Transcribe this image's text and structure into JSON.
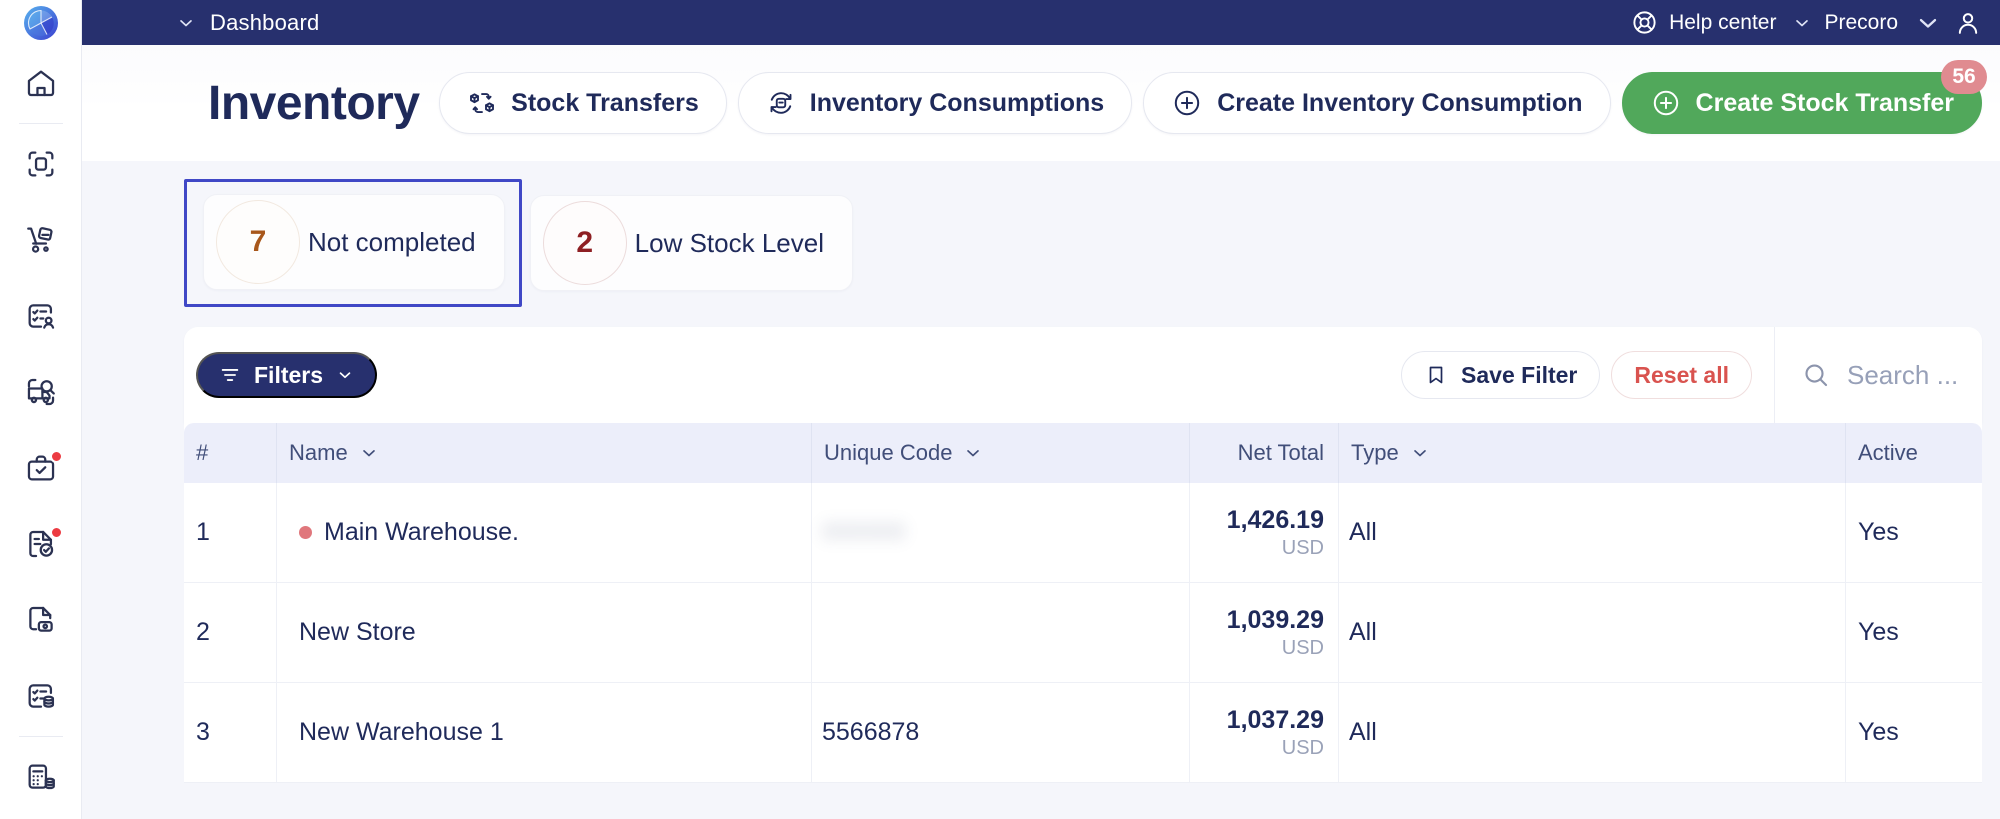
{
  "brand": {
    "accent_primary": "#27306e",
    "accent_green": "#51a85b",
    "focus_outline": "#4048c6",
    "badge_pink": "#e08b90",
    "danger": "#d9534f"
  },
  "topbar": {
    "menu_label": "Dashboard",
    "help_label": "Help center",
    "org_label": "Precoro",
    "icons": {
      "menu_chevron": "chevron-down-icon",
      "help": "lifebuoy-icon",
      "org_chevron": "chevron-down-icon",
      "account": "user-icon"
    }
  },
  "page": {
    "title": "Inventory",
    "actions": [
      {
        "label": "Stock Transfers",
        "icon": "stock-transfer-icon",
        "style": "outline"
      },
      {
        "label": "Inventory Consumptions",
        "icon": "inventory-consumption-icon",
        "style": "outline"
      },
      {
        "label": "Create Inventory Consumption",
        "icon": "plus-circle-icon",
        "style": "outline"
      },
      {
        "label": "Create Stock Transfer",
        "icon": "plus-circle-icon",
        "style": "primary",
        "badge": "56"
      }
    ]
  },
  "stats": [
    {
      "count": "7",
      "label": "Not completed",
      "tone": "orange",
      "focused": true
    },
    {
      "count": "2",
      "label": "Low Stock Level",
      "tone": "red",
      "focused": false
    }
  ],
  "filterbar": {
    "filters_label": "Filters",
    "save_filter_label": "Save Filter",
    "reset_label": "Reset all",
    "search_placeholder": "Search ...",
    "search_value": "",
    "icons": {
      "filters": "filter-icon",
      "filters_chevron": "chevron-down-icon",
      "save_filter": "bookmark-icon",
      "search": "search-icon"
    }
  },
  "table": {
    "columns": [
      {
        "key": "idx",
        "label": "#",
        "sortable": false
      },
      {
        "key": "name",
        "label": "Name",
        "sortable": true
      },
      {
        "key": "code",
        "label": "Unique Code",
        "sortable": true
      },
      {
        "key": "net",
        "label": "Net Total",
        "sortable": false
      },
      {
        "key": "type",
        "label": "Type",
        "sortable": true
      },
      {
        "key": "act",
        "label": "Active",
        "sortable": false
      }
    ],
    "rows": [
      {
        "idx": "1",
        "name": "Main Warehouse.",
        "status_dot": true,
        "code": "",
        "code_masked": true,
        "net_amount": "1,426.19",
        "net_currency": "USD",
        "type": "All",
        "active": "Yes"
      },
      {
        "idx": "2",
        "name": "New Store",
        "status_dot": false,
        "code": "",
        "code_masked": false,
        "net_amount": "1,039.29",
        "net_currency": "USD",
        "type": "All",
        "active": "Yes"
      },
      {
        "idx": "3",
        "name": "New Warehouse 1",
        "status_dot": false,
        "code": "5566878",
        "code_masked": false,
        "net_amount": "1,037.29",
        "net_currency": "USD",
        "type": "All",
        "active": "Yes"
      }
    ]
  },
  "sidebar": {
    "logo": "precoro-logo-icon",
    "items": [
      {
        "name": "home",
        "icon": "home-icon",
        "badge": false
      },
      {
        "name": "documents",
        "icon": "document-scan-icon",
        "badge": false
      },
      {
        "name": "purchase-requisitions",
        "icon": "hand-truck-icon",
        "badge": false
      },
      {
        "name": "suppliers",
        "icon": "list-user-icon",
        "badge": false
      },
      {
        "name": "receipts-tracking",
        "icon": "truck-search-icon",
        "badge": false
      },
      {
        "name": "approvals",
        "icon": "briefcase-check-icon",
        "badge": true
      },
      {
        "name": "invoices",
        "icon": "file-check-icon",
        "badge": true
      },
      {
        "name": "budgets",
        "icon": "file-lock-icon",
        "badge": false
      },
      {
        "name": "inventory",
        "icon": "list-database-icon",
        "badge": false
      },
      {
        "name": "reports",
        "icon": "calculator-database-icon",
        "badge": false
      }
    ]
  }
}
